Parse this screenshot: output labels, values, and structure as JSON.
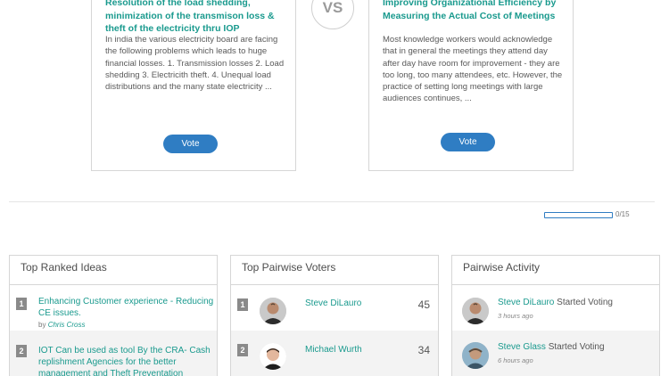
{
  "battle": {
    "left": {
      "title": "Resolution of the load shedding, minimization of the transmison loss & theft of the electricity thru IOP",
      "body": "In india the various electricity board are facing the following problems which leads to huge financial losses. 1. Transmission losses 2. Load shedding 3. Electricith theft. 4. Unequal load distributions and the many state electricity ...",
      "vote_label": "Vote"
    },
    "vs_label": "VS",
    "right": {
      "title": "Improving Organizational Efficiency by Measuring the Actual Cost of Meetings",
      "body": "Most knowledge workers would acknowledge that in general the meetings they attend day after day have room for improvement - they are too long, too many attendees, etc. However, the practice of setting long meetings with large audiences continues, ...",
      "vote_label": "Vote"
    }
  },
  "progress": {
    "label": "0/15",
    "fraction": 0.0
  },
  "top_ranked": {
    "title": "Top Ranked Ideas",
    "items": [
      {
        "rank": "1",
        "title": "Enhancing Customer experience - Reducing CE issues.",
        "by_prefix": "by",
        "author": "Chris Cross"
      },
      {
        "rank": "2",
        "title": "IOT Can be used as tool By the CRA- Cash replishment Agencies for the better management and Theft Preventation"
      }
    ]
  },
  "top_voters": {
    "title": "Top Pairwise Voters",
    "items": [
      {
        "rank": "1",
        "name": "Steve DiLauro",
        "count": "45"
      },
      {
        "rank": "2",
        "name": "Michael Wurth",
        "count": "34"
      }
    ]
  },
  "activity": {
    "title": "Pairwise Activity",
    "items": [
      {
        "name": "Steve DiLauro",
        "action": "Started Voting",
        "time": "3 hours ago"
      },
      {
        "name": "Steve Glass",
        "action": "Started Voting",
        "time": "6 hours ago"
      }
    ]
  },
  "colors": {
    "accent": "#1a9a8e",
    "button": "#2f7dc3",
    "rank_badge": "#8a8a8a"
  }
}
